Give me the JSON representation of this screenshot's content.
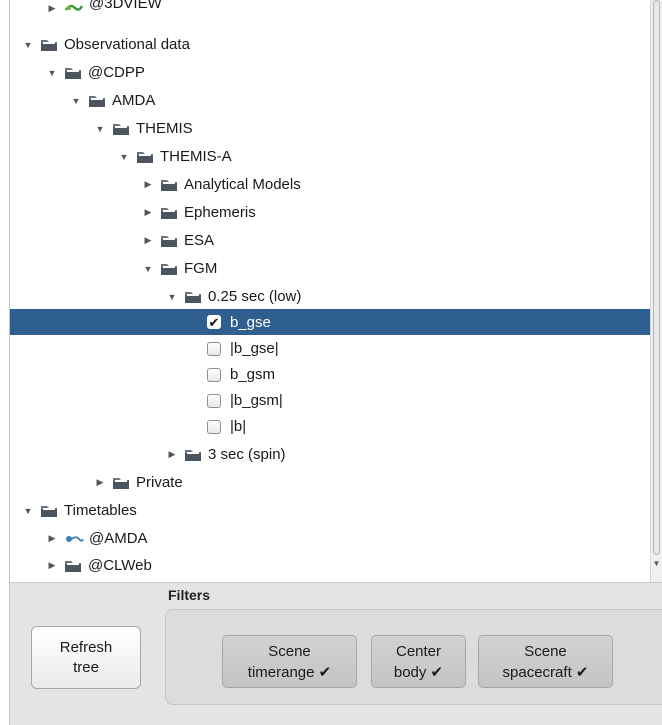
{
  "tree": {
    "rows": [
      {
        "label": "@3DVIEW",
        "toggle": "▶",
        "icon": "service-green"
      },
      {
        "label": "Observational data",
        "toggle": "▼",
        "icon": "folder"
      },
      {
        "label": "@CDPP",
        "toggle": "▼",
        "icon": "folder"
      },
      {
        "label": "AMDA",
        "toggle": "▼",
        "icon": "folder"
      },
      {
        "label": "THEMIS",
        "toggle": "▼",
        "icon": "folder"
      },
      {
        "label": "THEMIS-A",
        "toggle": "▼",
        "icon": "folder"
      },
      {
        "label": "Analytical Models",
        "toggle": "▶",
        "icon": "folder"
      },
      {
        "label": "Ephemeris",
        "toggle": "▶",
        "icon": "folder"
      },
      {
        "label": "ESA",
        "toggle": "▶",
        "icon": "folder"
      },
      {
        "label": "FGM",
        "toggle": "▼",
        "icon": "folder"
      },
      {
        "label": "0.25 sec (low)",
        "toggle": "▼",
        "icon": "folder"
      },
      {
        "label": "b_gse",
        "checked": "✔",
        "icon": "checkbox"
      },
      {
        "label": "|b_gse|",
        "checked": "",
        "icon": "checkbox"
      },
      {
        "label": "b_gsm",
        "checked": "",
        "icon": "checkbox"
      },
      {
        "label": "|b_gsm|",
        "checked": "",
        "icon": "checkbox"
      },
      {
        "label": "|b|",
        "checked": "",
        "icon": "checkbox"
      },
      {
        "label": "3 sec (spin)",
        "toggle": "▶",
        "icon": "folder"
      },
      {
        "label": "Private",
        "toggle": "▶",
        "icon": "folder"
      },
      {
        "label": "Timetables",
        "toggle": "▼",
        "icon": "folder"
      },
      {
        "label": "@AMDA",
        "toggle": "▶",
        "icon": "service-blue"
      },
      {
        "label": "@CLWeb",
        "toggle": "▶",
        "icon": "folder"
      }
    ]
  },
  "filters": {
    "title": "Filters",
    "refresh": {
      "line1": "Refresh",
      "line2": "tree"
    },
    "scene_timerange": {
      "line1": "Scene",
      "line2": "timerange ✔"
    },
    "center_body": {
      "line1": "Center",
      "line2": "body ✔"
    },
    "scene_spacecraft": {
      "line1": "Scene",
      "line2": "spacecraft ✔"
    }
  },
  "colors": {
    "selection": "#2f5f8e",
    "folder": "#4a5560",
    "panel_bg": "#e4e4e4"
  },
  "selected_row": "b_gse"
}
